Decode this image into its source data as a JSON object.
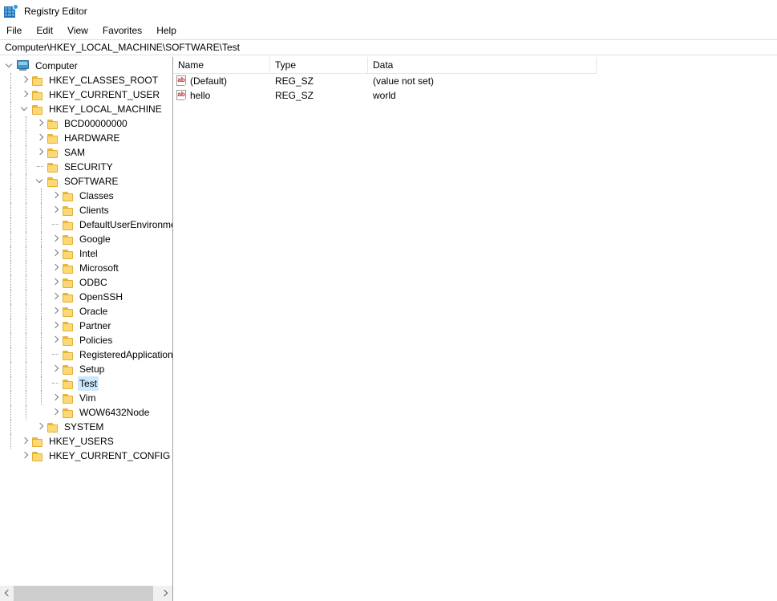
{
  "window": {
    "title": "Registry Editor",
    "app_icon": "registry-editor-icon"
  },
  "menubar": {
    "items": [
      {
        "label": "File"
      },
      {
        "label": "Edit"
      },
      {
        "label": "View"
      },
      {
        "label": "Favorites"
      },
      {
        "label": "Help"
      }
    ]
  },
  "address": {
    "path": "Computer\\HKEY_LOCAL_MACHINE\\SOFTWARE\\Test"
  },
  "tree": {
    "nodes": [
      {
        "label": "Computer",
        "depth": 0,
        "state": "expanded",
        "icon": "computer-icon"
      },
      {
        "label": "HKEY_CLASSES_ROOT",
        "depth": 1,
        "state": "collapsed",
        "icon": "folder-icon"
      },
      {
        "label": "HKEY_CURRENT_USER",
        "depth": 1,
        "state": "collapsed",
        "icon": "folder-icon"
      },
      {
        "label": "HKEY_LOCAL_MACHINE",
        "depth": 1,
        "state": "expanded",
        "icon": "folder-icon"
      },
      {
        "label": "BCD00000000",
        "depth": 2,
        "state": "collapsed",
        "icon": "folder-icon"
      },
      {
        "label": "HARDWARE",
        "depth": 2,
        "state": "collapsed",
        "icon": "folder-icon"
      },
      {
        "label": "SAM",
        "depth": 2,
        "state": "collapsed",
        "icon": "folder-icon"
      },
      {
        "label": "SECURITY",
        "depth": 2,
        "state": "leaf",
        "icon": "folder-icon"
      },
      {
        "label": "SOFTWARE",
        "depth": 2,
        "state": "expanded",
        "icon": "folder-icon"
      },
      {
        "label": "Classes",
        "depth": 3,
        "state": "collapsed",
        "icon": "folder-icon"
      },
      {
        "label": "Clients",
        "depth": 3,
        "state": "collapsed",
        "icon": "folder-icon"
      },
      {
        "label": "DefaultUserEnvironment",
        "depth": 3,
        "state": "leaf",
        "icon": "folder-icon"
      },
      {
        "label": "Google",
        "depth": 3,
        "state": "collapsed",
        "icon": "folder-icon"
      },
      {
        "label": "Intel",
        "depth": 3,
        "state": "collapsed",
        "icon": "folder-icon"
      },
      {
        "label": "Microsoft",
        "depth": 3,
        "state": "collapsed",
        "icon": "folder-icon"
      },
      {
        "label": "ODBC",
        "depth": 3,
        "state": "collapsed",
        "icon": "folder-icon"
      },
      {
        "label": "OpenSSH",
        "depth": 3,
        "state": "collapsed",
        "icon": "folder-icon"
      },
      {
        "label": "Oracle",
        "depth": 3,
        "state": "collapsed",
        "icon": "folder-icon"
      },
      {
        "label": "Partner",
        "depth": 3,
        "state": "collapsed",
        "icon": "folder-icon"
      },
      {
        "label": "Policies",
        "depth": 3,
        "state": "collapsed",
        "icon": "folder-icon"
      },
      {
        "label": "RegisteredApplications",
        "depth": 3,
        "state": "leaf",
        "icon": "folder-icon"
      },
      {
        "label": "Setup",
        "depth": 3,
        "state": "collapsed",
        "icon": "folder-icon"
      },
      {
        "label": "Test",
        "depth": 3,
        "state": "leaf",
        "icon": "folder-icon",
        "selected": true
      },
      {
        "label": "Vim",
        "depth": 3,
        "state": "collapsed",
        "icon": "folder-icon"
      },
      {
        "label": "WOW6432Node",
        "depth": 3,
        "state": "collapsed",
        "icon": "folder-icon"
      },
      {
        "label": "SYSTEM",
        "depth": 2,
        "state": "collapsed",
        "icon": "folder-icon"
      },
      {
        "label": "HKEY_USERS",
        "depth": 1,
        "state": "collapsed",
        "icon": "folder-icon"
      },
      {
        "label": "HKEY_CURRENT_CONFIG",
        "depth": 1,
        "state": "collapsed",
        "icon": "folder-icon"
      }
    ],
    "selected_label": "Test",
    "hscrollbar": {
      "left_arrow": "scroll-left-icon",
      "right_arrow": "scroll-right-icon"
    }
  },
  "list": {
    "columns": [
      {
        "label": "Name"
      },
      {
        "label": "Type"
      },
      {
        "label": "Data"
      }
    ],
    "rows": [
      {
        "name": "(Default)",
        "type": "REG_SZ",
        "data": "(value not set)",
        "icon": "string-value-icon"
      },
      {
        "name": "hello",
        "type": "REG_SZ",
        "data": "world",
        "icon": "string-value-icon"
      }
    ]
  },
  "colors": {
    "selection": "#cce8ff",
    "folder": "#fdd976",
    "folder_border": "#e3ad33",
    "accent": "#3e9ad6",
    "value_icon_text": "#c02020"
  }
}
